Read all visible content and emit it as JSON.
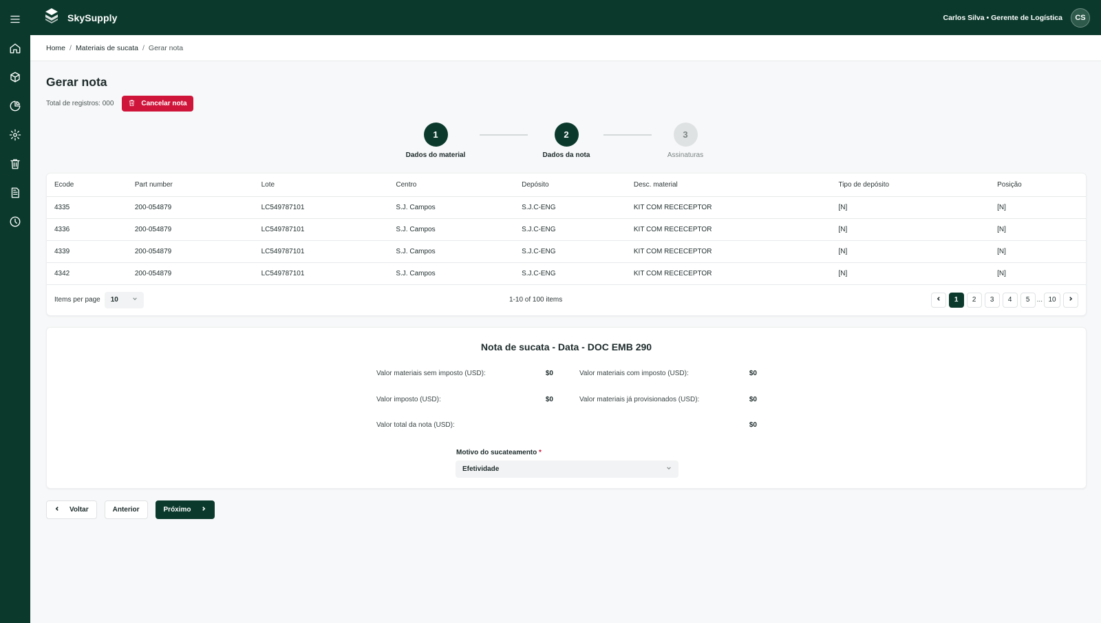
{
  "app": {
    "name": "SkySupply",
    "user": "Carlos Silva • Gerente de Logística",
    "initials": "CS"
  },
  "sidebar": {
    "icons": [
      "menu-icon",
      "home-icon",
      "box-icon",
      "chart-pie-icon",
      "gear-icon",
      "trash-icon",
      "document-icon",
      "clock-icon"
    ]
  },
  "breadcrumb": [
    "Home",
    "Materiais de sucata",
    "Gerar nota"
  ],
  "page": {
    "title": "Gerar nota",
    "total_label": "Total de registros: 000",
    "cancel_label": "Cancelar nota"
  },
  "stepper": [
    {
      "number": "1",
      "label": "Dados do material",
      "state": "active"
    },
    {
      "number": "2",
      "label": "Dados da nota",
      "state": "active"
    },
    {
      "number": "3",
      "label": "Assinaturas",
      "state": "inactive"
    }
  ],
  "table": {
    "columns": [
      "Ecode",
      "Part number",
      "Lote",
      "Centro",
      "Depósito",
      "Desc. material",
      "Tipo de depósito",
      "Posição"
    ],
    "rows": [
      [
        "4335",
        "200-054879",
        "LC549787101",
        "S.J. Campos",
        "S.J.C-ENG",
        "KIT COM RECECEPTOR",
        "[N]",
        "[N]"
      ],
      [
        "4336",
        "200-054879",
        "LC549787101",
        "S.J. Campos",
        "S.J.C-ENG",
        "KIT COM RECECEPTOR",
        "[N]",
        "[N]"
      ],
      [
        "4339",
        "200-054879",
        "LC549787101",
        "S.J. Campos",
        "S.J.C-ENG",
        "KIT COM RECECEPTOR",
        "[N]",
        "[N]"
      ],
      [
        "4342",
        "200-054879",
        "LC549787101",
        "S.J. Campos",
        "S.J.C-ENG",
        "KIT COM RECECEPTOR",
        "[N]",
        "[N]"
      ]
    ],
    "items_per_page_label": "Items per page",
    "items_per_page_value": "10",
    "range_label": "1-10 of 100 items",
    "pages": [
      "1",
      "2",
      "3",
      "4",
      "5"
    ],
    "ellipsis": "...",
    "last_page": "10",
    "current_page": "1"
  },
  "note": {
    "title": "Nota de sucata - Data - DOC EMB 290",
    "fields": {
      "sem_imposto_label": "Valor materiais sem imposto (USD):",
      "sem_imposto_value": "$0",
      "com_imposto_label": "Valor materiais com imposto (USD):",
      "com_imposto_value": "$0",
      "imposto_label": "Valor imposto (USD):",
      "imposto_value": "$0",
      "provisionados_label": "Valor materiais já provisionados (USD):",
      "provisionados_value": "$0",
      "total_label": "Valor total da nota (USD):",
      "total_value": "$0"
    },
    "motivo_label": "Motivo do sucateamento",
    "required_mark": "*",
    "motivo_value": "Efetividade"
  },
  "actions": {
    "back": "Voltar",
    "previous": "Anterior",
    "next": "Próximo"
  },
  "colors": {
    "brand": "#0b3a2c",
    "danger": "#d0153b",
    "background": "#f7f8f9"
  }
}
